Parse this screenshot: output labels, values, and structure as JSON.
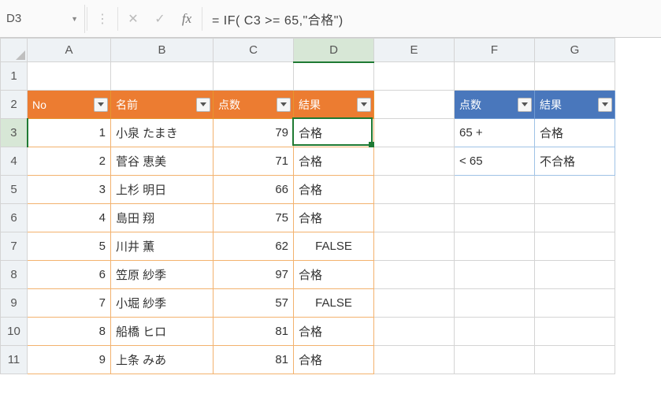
{
  "formula_bar": {
    "cell_ref": "D3",
    "formula": "= IF( C3 >= 65,\"合格\")"
  },
  "columns": [
    "A",
    "B",
    "C",
    "D",
    "E",
    "F",
    "G"
  ],
  "rows": [
    "1",
    "2",
    "3",
    "4",
    "5",
    "6",
    "7",
    "8",
    "9",
    "10",
    "11"
  ],
  "selected_cell": "D3",
  "table1": {
    "headers": {
      "no": "No",
      "name": "名前",
      "score": "点数",
      "result": "結果"
    },
    "rows": [
      {
        "no": "1",
        "name": "小泉 たまき",
        "score": "79",
        "result": "合格"
      },
      {
        "no": "2",
        "name": "菅谷 恵美",
        "score": "71",
        "result": "合格"
      },
      {
        "no": "3",
        "name": "上杉 明日",
        "score": "66",
        "result": "合格"
      },
      {
        "no": "4",
        "name": "島田 翔",
        "score": "75",
        "result": "合格"
      },
      {
        "no": "5",
        "name": "川井 薫",
        "score": "62",
        "result": "FALSE"
      },
      {
        "no": "6",
        "name": "笠原 紗季",
        "score": "97",
        "result": "合格"
      },
      {
        "no": "7",
        "name": "小堀 紗季",
        "score": "57",
        "result": "FALSE"
      },
      {
        "no": "8",
        "name": "船橋 ヒロ",
        "score": "81",
        "result": "合格"
      },
      {
        "no": "9",
        "name": "上条 みあ",
        "score": "81",
        "result": "合格"
      }
    ]
  },
  "table2": {
    "headers": {
      "score": "点数",
      "result": "結果"
    },
    "rows": [
      {
        "score": "65 +",
        "result": "合格"
      },
      {
        "score": "< 65",
        "result": "不合格"
      }
    ]
  }
}
